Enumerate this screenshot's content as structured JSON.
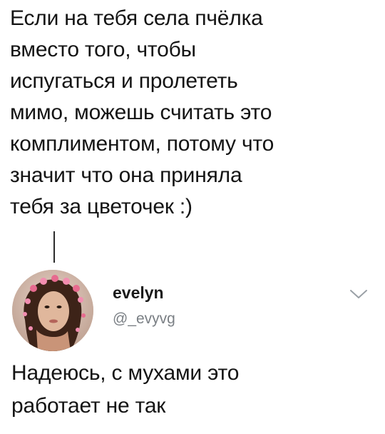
{
  "original_tweet": {
    "lines": [
      "Если на тебя села пчёлка",
      "вместо того, чтобы",
      "испугаться и пролететь",
      "мимо, можешь считать это",
      "комплиментом, потому что",
      "значит что она приняла",
      "тебя за цветочек :)"
    ]
  },
  "reply": {
    "author": {
      "name": "evelyn",
      "handle": "@_evyvg",
      "avatar_icon": "profile-photo"
    },
    "menu_icon": "chevron-down-icon",
    "lines": [
      "Надеюсь, с мухами это",
      "работает не так"
    ]
  },
  "colors": {
    "text": "#141414",
    "handle": "#7a7f84",
    "chevron": "#9aa0a6",
    "thread_line": "#2b2b2b"
  }
}
